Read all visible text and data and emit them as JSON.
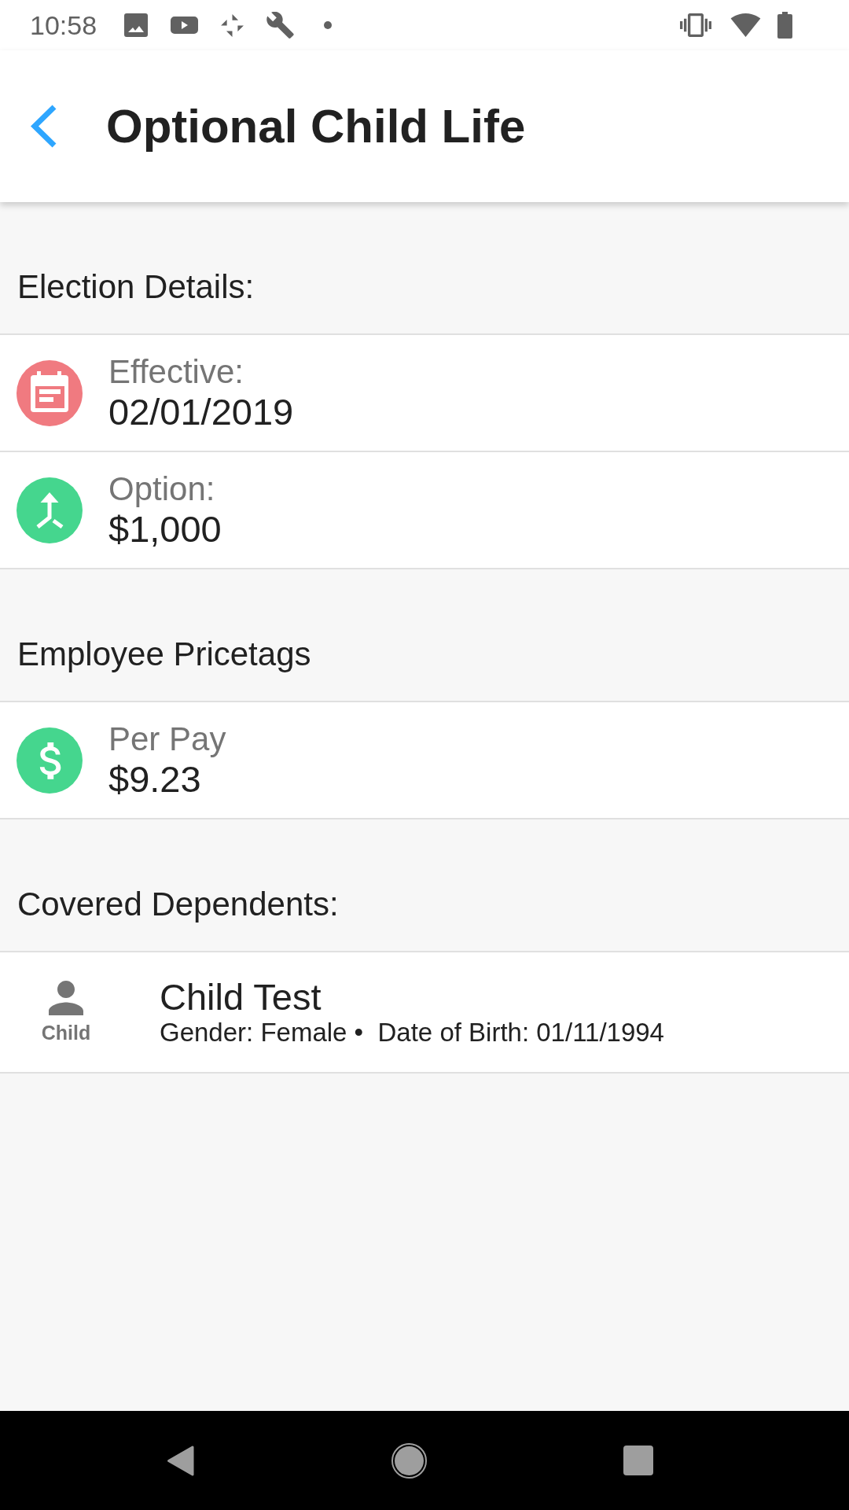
{
  "status_bar": {
    "time": "10:58"
  },
  "header": {
    "title": "Optional Child Life"
  },
  "sections": [
    {
      "heading": "Election Details:",
      "kind": "details",
      "items": [
        {
          "kind": "calendar",
          "label": "Effective:",
          "value": "02/01/2019",
          "color": "#f07a80"
        },
        {
          "kind": "option",
          "label": "Option:",
          "value": "$1,000",
          "color": "#45d68e"
        }
      ]
    },
    {
      "heading": "Employee Pricetags",
      "kind": "details",
      "items": [
        {
          "kind": "money",
          "label": "Per Pay",
          "value": "$9.23",
          "color": "#45d68e"
        }
      ]
    },
    {
      "heading": "Covered Dependents:",
      "kind": "dependents",
      "dependents": [
        {
          "relation": "Child",
          "name": "Child Test",
          "details": "Gender: Female •  Date of Birth: 01/11/1994"
        }
      ]
    }
  ]
}
